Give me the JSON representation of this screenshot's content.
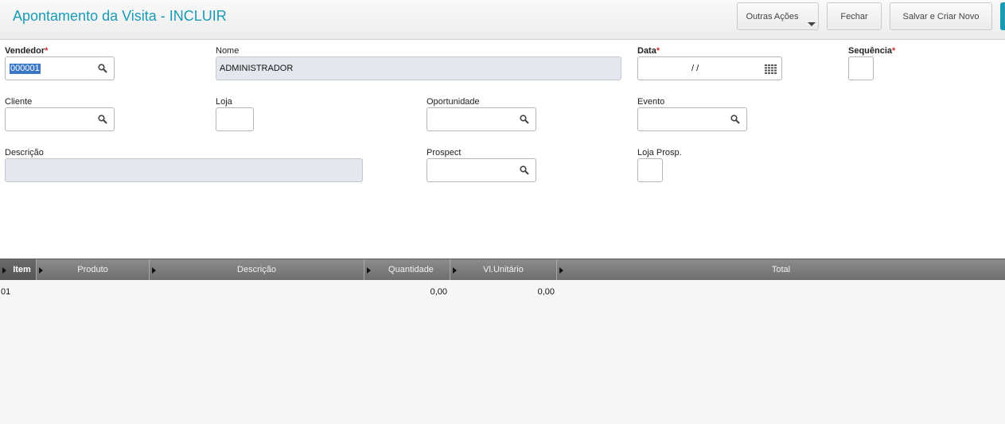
{
  "header": {
    "title": "Apontamento da Visita - INCLUIR",
    "buttons": {
      "outras": "Outras Ações",
      "fechar": "Fechar",
      "salvar_novo": "Salvar e Criar Novo"
    }
  },
  "form": {
    "vendedor": {
      "label": "Vendedor",
      "value": "000001"
    },
    "nome": {
      "label": "Nome",
      "value": "ADMINISTRADOR"
    },
    "data": {
      "label": "Data",
      "value": "/ /"
    },
    "sequencia": {
      "label": "Sequência"
    },
    "cliente": {
      "label": "Cliente"
    },
    "loja": {
      "label": "Loja"
    },
    "oportunidade": {
      "label": "Oportunidade"
    },
    "evento": {
      "label": "Evento"
    },
    "descricao": {
      "label": "Descrição"
    },
    "prospect": {
      "label": "Prospect"
    },
    "loja_prosp": {
      "label": "Loja Prosp."
    },
    "required_mark": "*"
  },
  "grid": {
    "columns": [
      "Item",
      "Produto",
      "Descrição",
      "Quantidade",
      "Vl.Unitário",
      "Total"
    ],
    "rows": [
      {
        "item": "01",
        "produto": "",
        "descricao": "",
        "quantidade": "0,00",
        "vl_unitario": "0,00",
        "total": ""
      }
    ]
  },
  "colors": {
    "accent": "#1a9bb5",
    "required": "#d62b2b"
  },
  "icons": {
    "lookup": "search-icon",
    "date": "calendar-icon"
  }
}
